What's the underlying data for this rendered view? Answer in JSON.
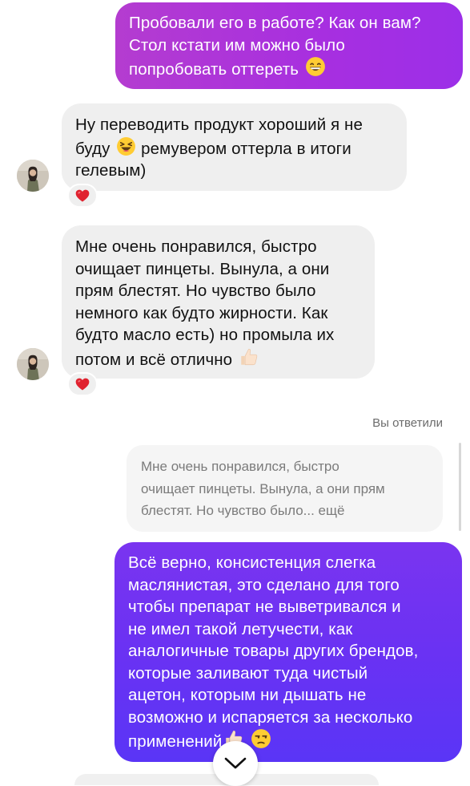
{
  "messages": [
    {
      "direction": "outgoing",
      "lines": [
        "Пробовали его в работе? Как он вам?",
        "Стол кстати им можно было",
        "попробовать оттереть"
      ],
      "emoji": "grinning-face"
    },
    {
      "direction": "incoming",
      "lines": [
        "Ну переводить продукт хороший я не",
        "буду",
        "ремувером оттерла в итоги",
        "гелевым)"
      ],
      "emoji": "laughing-face",
      "reaction": "red-heart"
    },
    {
      "direction": "incoming",
      "lines": [
        "Мне очень понравился, быстро",
        "очищает пинцеты. Вынула, а они",
        "прям блестят. Но чувство было",
        "немного как будто жирности. Как",
        "будто масло есть) но промыла их",
        "потом и всё отлично"
      ],
      "emoji": "thumbs-up",
      "reaction": "red-heart"
    }
  ],
  "reply": {
    "label": "Вы ответили",
    "quote_lines": [
      "Мне очень понравился, быстро",
      "очищает пинцеты. Вынула, а они прям",
      "блестят. Но чувство было... ещё"
    ]
  },
  "outgoing_reply": {
    "lines": [
      "Всё верно, консистенция слегка",
      "маслянистая, это сделано для того",
      "чтобы препарат не выветривался и",
      "не имел такой летучести, как",
      "аналогичные товары других брендов,",
      "которые заливают туда чистый",
      "ацетон, которым ни дышать не",
      "возможно и испаряется за несколько",
      "применений"
    ],
    "emojis": [
      "thumbs-up",
      "unamused-face"
    ]
  },
  "controls": {
    "scroll_down_icon": "chevron-down-icon"
  },
  "colors": {
    "outgoing_top": "#a72fe0",
    "outgoing_bottom": "#6a32f3",
    "incoming_bg": "#efefef",
    "heart": "#e0222f"
  }
}
